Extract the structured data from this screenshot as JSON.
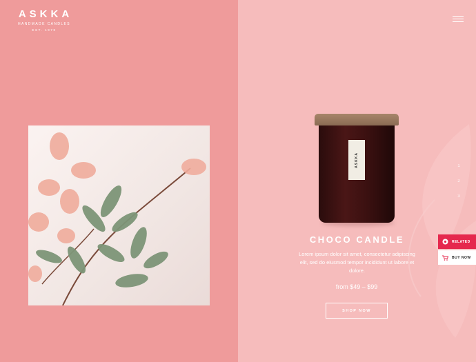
{
  "brand": {
    "name": "ASKKA",
    "tagline": "HANDMADE CANDLES",
    "established": "EST. 1970"
  },
  "header": {
    "menu_icon": "hamburger-menu-icon"
  },
  "product": {
    "label_text": "ASKKA",
    "title": "CHOCO CANDLE",
    "description": "Lorem ipsum dolor sit amet, consectetur adipiscing elit, sed do eiusmod tempor incididunt ut labore et dolore.",
    "price": "from $49 – $99",
    "cta_label": "SHOP NOW"
  },
  "slider": {
    "dots": [
      "1",
      "2",
      "3"
    ]
  },
  "side_tabs": {
    "related_label": "RELATED",
    "related_icon": "related-circle-icon",
    "buy_now_label": "BUY NOW",
    "buy_now_icon": "cart-icon"
  },
  "colors": {
    "left_bg": "#ef9b9b",
    "right_bg": "#f6bcbc",
    "accent": "#e5284d",
    "text": "#ffffff"
  }
}
